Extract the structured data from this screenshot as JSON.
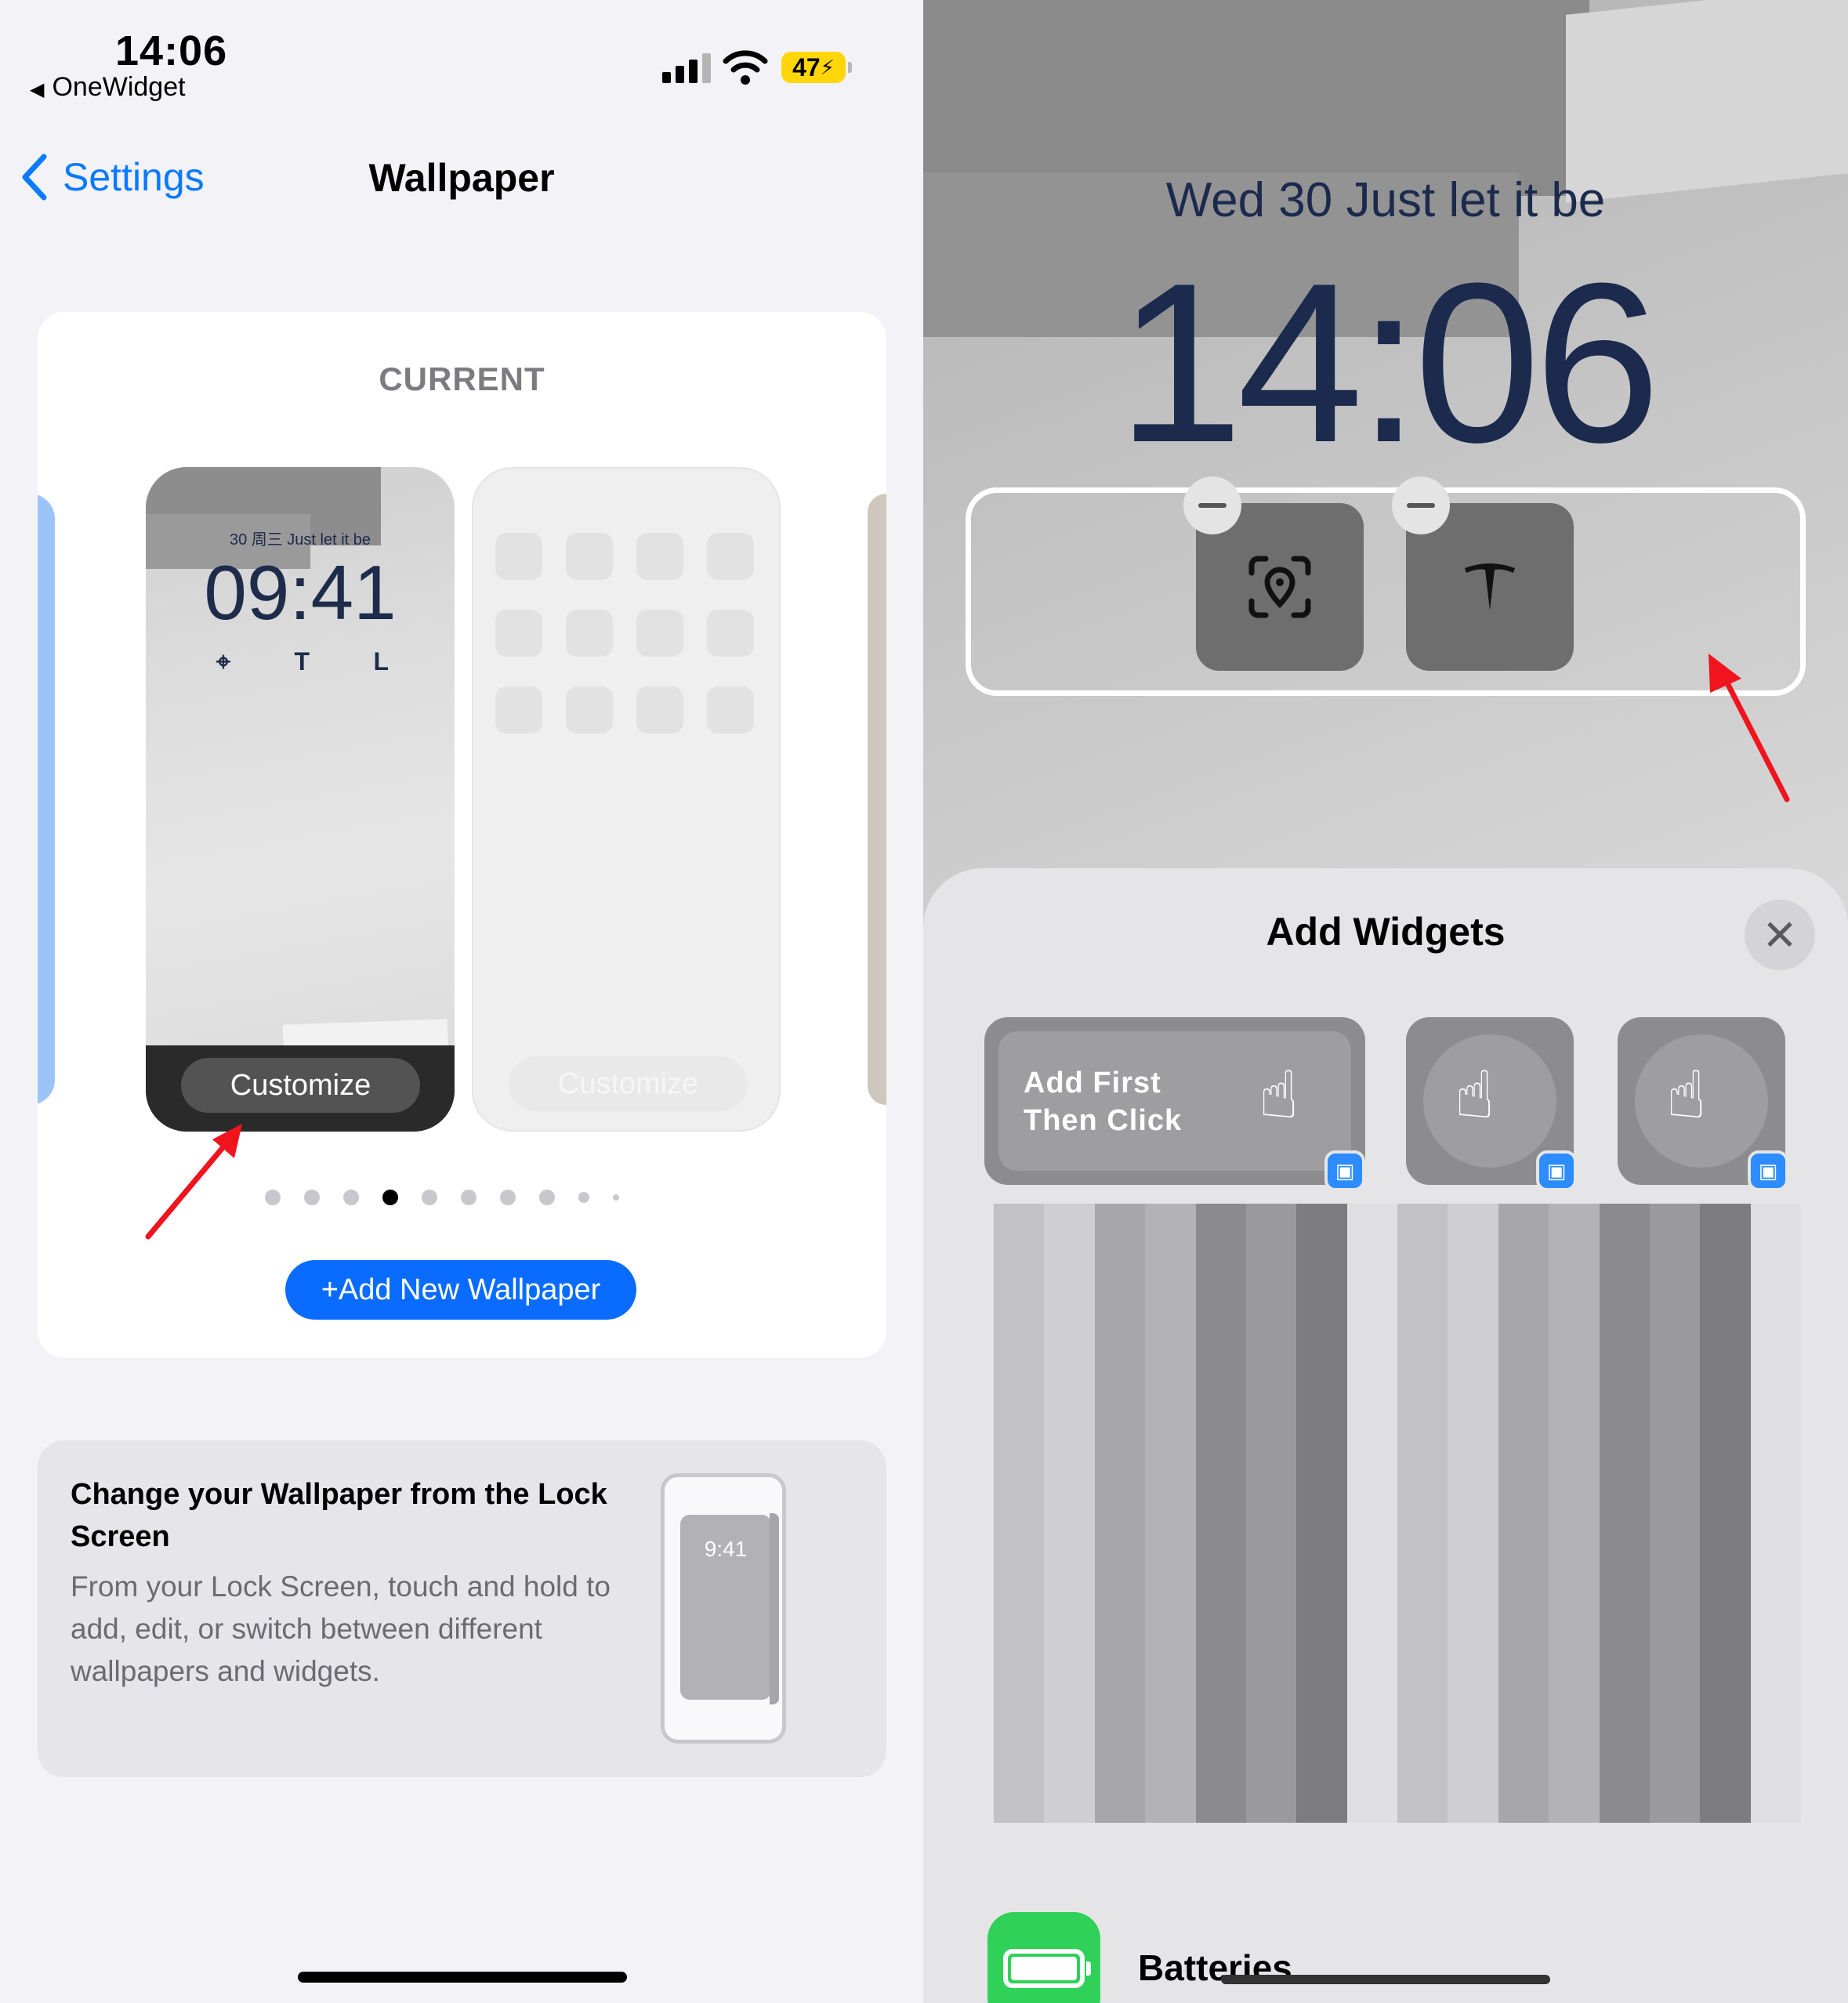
{
  "left": {
    "status": {
      "time": "14:06",
      "back_app": "OneWidget",
      "battery": "47",
      "back_glyph": "◀"
    },
    "nav": {
      "back_label": "Settings",
      "title": "Wallpaper"
    },
    "current_card": {
      "label": "CURRENT",
      "lock_preview": {
        "date": "30 周三  Just let it be",
        "time": "09:41",
        "customize": "Customize"
      },
      "home_preview": {
        "customize": "Customize"
      },
      "page_dots": {
        "count": 10,
        "active_index": 3
      },
      "add_button": "+Add New Wallpaper"
    },
    "info_card": {
      "title": "Change your Wallpaper from the Lock Screen",
      "body": "From your Lock Screen, touch and hold to add, edit, or switch between different wallpapers and widgets.",
      "phone_time": "9:41"
    }
  },
  "right": {
    "lock_screen": {
      "date": "Wed 30  Just let it be",
      "time": "14:06"
    },
    "lock_widgets": [
      {
        "icon": "location-scan-icon"
      },
      {
        "icon": "tesla-logo-icon"
      }
    ],
    "sheet": {
      "title": "Add Widgets",
      "close_glyph": "✕",
      "widgets": [
        {
          "text": "Add First\nThen Click",
          "icon": "tap-hand-icon"
        },
        {
          "icon": "tap-hand-icon"
        },
        {
          "icon": "tap-hand-icon"
        }
      ],
      "app_row": {
        "label": "Batteries",
        "icon": "battery-app-icon",
        "color": "#2fd158"
      }
    }
  },
  "colors": {
    "accent": "#0a7aff",
    "button_blue": "#0a6cff",
    "annotation_arrow": "#f0141e",
    "lock_text": "#1b2a4d"
  }
}
